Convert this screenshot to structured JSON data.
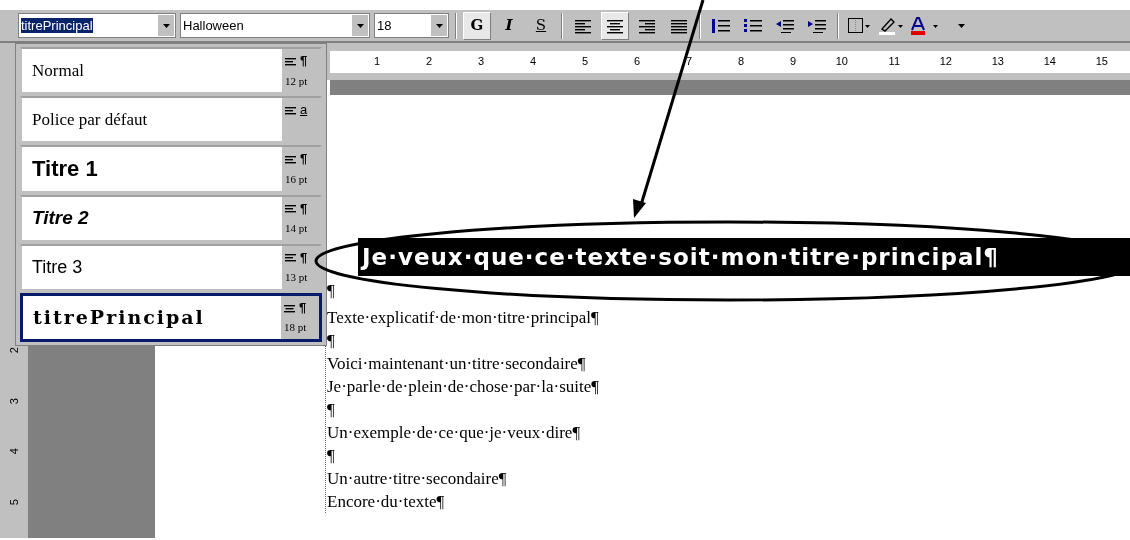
{
  "toolbar": {
    "style_box": {
      "value": "titrePrincipal"
    },
    "font_box": {
      "value": "Halloween"
    },
    "size_box": {
      "value": "18"
    },
    "format_buttons": [
      {
        "label": "G",
        "kind": "bold",
        "pressed": true
      },
      {
        "label": "I",
        "kind": "italic",
        "pressed": false
      },
      {
        "label": "S",
        "kind": "underline",
        "pressed": false
      }
    ],
    "align_buttons": [
      {
        "kind": "left",
        "selected": false
      },
      {
        "kind": "center",
        "selected": true
      },
      {
        "kind": "right",
        "selected": false
      },
      {
        "kind": "justify",
        "selected": false
      }
    ]
  },
  "ruler": {
    "numbers": [
      "1",
      "2",
      "3",
      "4",
      "5",
      "6",
      "7",
      "8",
      "9",
      "10",
      "11",
      "12",
      "13",
      "14",
      "15"
    ]
  },
  "vertical_ruler": {
    "numbers": [
      "2",
      "3",
      "4",
      "5"
    ]
  },
  "style_list": [
    {
      "name": "Normal",
      "kind": "serif",
      "mark": "¶",
      "size": "12 pt",
      "selected": false
    },
    {
      "name": "Police par défaut",
      "kind": "serif",
      "mark": "a",
      "selected": false
    },
    {
      "name": "Titre 1",
      "kind": "bold",
      "mark": "¶",
      "size": "16 pt",
      "selected": false
    },
    {
      "name": "Titre 2",
      "kind": "bolditalic",
      "mark": "¶",
      "size": "14 pt",
      "selected": false
    },
    {
      "name": "Titre 3",
      "kind": "sans",
      "mark": "¶",
      "size": "13 pt",
      "selected": false
    },
    {
      "name": "titrePrincipal",
      "kind": "display",
      "mark": "¶",
      "size": "18 pt",
      "selected": true
    }
  ],
  "document": {
    "heading": "Je·veux·que·ce·texte·soit·mon·titre·principal¶",
    "paragraphs": [
      "¶",
      "Texte·explicatif·de·mon·titre·principal¶",
      "¶",
      "Voici·maintenant·un·titre·secondaire¶",
      "Je·parle·de·plein·de·chose·par·la·suite¶",
      "¶",
      "Un·exemple·de·ce·que·je·veux·dire¶",
      "¶",
      "Un·autre·titre·secondaire¶",
      "Encore·du·texte¶"
    ]
  }
}
